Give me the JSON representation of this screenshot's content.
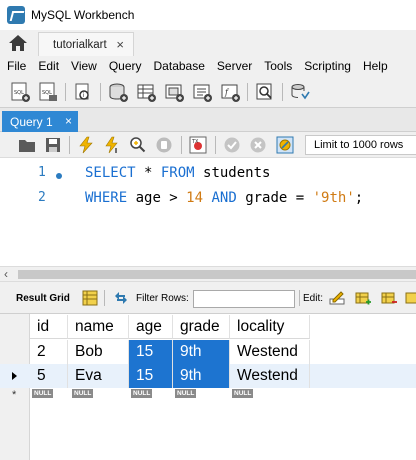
{
  "window": {
    "title": "MySQL Workbench"
  },
  "connection_tab": {
    "label": "tutorialkart",
    "close_glyph": "×"
  },
  "menu": [
    "File",
    "Edit",
    "View",
    "Query",
    "Database",
    "Server",
    "Tools",
    "Scripting",
    "Help"
  ],
  "toolbar_icons": [
    "new-sql-tab-icon",
    "open-sql-script-icon",
    "inspector-icon",
    "create-schema-icon",
    "create-table-icon",
    "create-view-icon",
    "create-procedure-icon",
    "create-function-icon",
    "search-table-data-icon",
    "reconnect-icon"
  ],
  "query_tab": {
    "label": "Query 1",
    "close_glyph": "×"
  },
  "editor_toolbar": {
    "limit_label": "Limit to 1000 rows"
  },
  "editor": {
    "lines": [
      {
        "num": "1",
        "kw1": "SELECT",
        "t1": " * ",
        "kw2": "FROM",
        "t2": " students"
      },
      {
        "num": "2",
        "kw1": "WHERE",
        "t1": " age > ",
        "n1": "14",
        "t2": " ",
        "kw2": "AND",
        "t3": " grade = ",
        "s1": "'9th'",
        "t4": ";"
      }
    ]
  },
  "result_toolbar": {
    "result_grid_label": "Result Grid",
    "filter_label": "Filter Rows:",
    "filter_value": "",
    "edit_label": "Edit:"
  },
  "grid": {
    "columns": [
      "id",
      "name",
      "age",
      "grade",
      "locality"
    ],
    "rows": [
      [
        "2",
        "Bob",
        "15",
        "9th",
        "Westend"
      ],
      [
        "5",
        "Eva",
        "15",
        "9th",
        "Westend"
      ]
    ],
    "null_label": "NULL",
    "new_row_marker": "*"
  }
}
